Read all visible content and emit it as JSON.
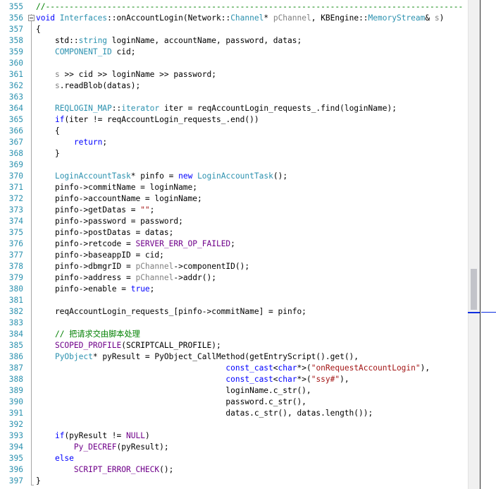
{
  "editor": {
    "first_line_number": 355,
    "lines": [
      {
        "n": "355",
        "t": [
          {
            "c": "cm",
            "s": "//----------------------------------------------------------------------------------------------"
          }
        ]
      },
      {
        "n": "356",
        "t": [
          {
            "c": "kw",
            "s": "void"
          },
          {
            "s": " "
          },
          {
            "c": "ty",
            "s": "Interfaces"
          },
          {
            "s": "::onAccountLogin(Network::"
          },
          {
            "c": "ty",
            "s": "Channel"
          },
          {
            "s": "* "
          },
          {
            "c": "par",
            "s": "pChannel"
          },
          {
            "s": ", KBEngine::"
          },
          {
            "c": "ty",
            "s": "MemoryStream"
          },
          {
            "s": "& "
          },
          {
            "c": "par",
            "s": "s"
          },
          {
            "s": ")"
          }
        ]
      },
      {
        "n": "357",
        "t": [
          {
            "s": "{"
          }
        ]
      },
      {
        "n": "358",
        "t": [
          {
            "s": "    std::"
          },
          {
            "c": "ty",
            "s": "string"
          },
          {
            "s": " loginName, accountName, password, datas;"
          }
        ]
      },
      {
        "n": "359",
        "t": [
          {
            "s": "    "
          },
          {
            "c": "ty",
            "s": "COMPONENT_ID"
          },
          {
            "s": " cid;"
          }
        ]
      },
      {
        "n": "360",
        "t": [
          {
            "s": ""
          }
        ]
      },
      {
        "n": "361",
        "t": [
          {
            "s": "    "
          },
          {
            "c": "par",
            "s": "s"
          },
          {
            "s": " >> cid >> loginName >> password;"
          }
        ]
      },
      {
        "n": "362",
        "t": [
          {
            "s": "    "
          },
          {
            "c": "par",
            "s": "s"
          },
          {
            "s": ".readBlob(datas);"
          }
        ]
      },
      {
        "n": "363",
        "t": [
          {
            "s": ""
          }
        ]
      },
      {
        "n": "364",
        "t": [
          {
            "s": "    "
          },
          {
            "c": "ty",
            "s": "REQLOGIN_MAP"
          },
          {
            "s": "::"
          },
          {
            "c": "ty",
            "s": "iterator"
          },
          {
            "s": " iter = reqAccountLogin_requests_.find(loginName);"
          }
        ]
      },
      {
        "n": "365",
        "t": [
          {
            "s": "    "
          },
          {
            "c": "kw",
            "s": "if"
          },
          {
            "s": "(iter != reqAccountLogin_requests_.end())"
          }
        ]
      },
      {
        "n": "366",
        "t": [
          {
            "s": "    {"
          }
        ]
      },
      {
        "n": "367",
        "t": [
          {
            "s": "        "
          },
          {
            "c": "kw",
            "s": "return"
          },
          {
            "s": ";"
          }
        ]
      },
      {
        "n": "368",
        "t": [
          {
            "s": "    }"
          }
        ]
      },
      {
        "n": "369",
        "t": [
          {
            "s": ""
          }
        ]
      },
      {
        "n": "370",
        "t": [
          {
            "s": "    "
          },
          {
            "c": "ty",
            "s": "LoginAccountTask"
          },
          {
            "s": "* pinfo = "
          },
          {
            "c": "kw",
            "s": "new"
          },
          {
            "s": " "
          },
          {
            "c": "ty",
            "s": "LoginAccountTask"
          },
          {
            "s": "();"
          }
        ]
      },
      {
        "n": "371",
        "t": [
          {
            "s": "    pinfo->commitName = loginName;"
          }
        ]
      },
      {
        "n": "372",
        "t": [
          {
            "s": "    pinfo->accountName = loginName;"
          }
        ]
      },
      {
        "n": "373",
        "t": [
          {
            "s": "    pinfo->getDatas = "
          },
          {
            "c": "str",
            "s": "\"\""
          },
          {
            "s": ";"
          }
        ]
      },
      {
        "n": "374",
        "t": [
          {
            "s": "    pinfo->password = password;"
          }
        ]
      },
      {
        "n": "375",
        "t": [
          {
            "s": "    pinfo->postDatas = datas;"
          }
        ]
      },
      {
        "n": "376",
        "t": [
          {
            "s": "    pinfo->retcode = "
          },
          {
            "c": "mac",
            "s": "SERVER_ERR_OP_FAILED"
          },
          {
            "s": ";"
          }
        ]
      },
      {
        "n": "377",
        "t": [
          {
            "s": "    pinfo->baseappID = cid;"
          }
        ]
      },
      {
        "n": "378",
        "t": [
          {
            "s": "    pinfo->dbmgrID = "
          },
          {
            "c": "par",
            "s": "pChannel"
          },
          {
            "s": "->componentID();"
          }
        ]
      },
      {
        "n": "379",
        "t": [
          {
            "s": "    pinfo->address = "
          },
          {
            "c": "par",
            "s": "pChannel"
          },
          {
            "s": "->addr();"
          }
        ]
      },
      {
        "n": "380",
        "t": [
          {
            "s": "    pinfo->enable = "
          },
          {
            "c": "kw",
            "s": "true"
          },
          {
            "s": ";"
          }
        ]
      },
      {
        "n": "381",
        "t": [
          {
            "s": ""
          }
        ]
      },
      {
        "n": "382",
        "t": [
          {
            "s": "    reqAccountLogin_requests_[pinfo->commitName] = pinfo;"
          }
        ]
      },
      {
        "n": "383",
        "t": [
          {
            "s": ""
          }
        ]
      },
      {
        "n": "384",
        "t": [
          {
            "s": "    "
          },
          {
            "c": "cm",
            "s": "// 把请求交由脚本处理"
          }
        ]
      },
      {
        "n": "385",
        "t": [
          {
            "s": "    "
          },
          {
            "c": "mac",
            "s": "SCOPED_PROFILE"
          },
          {
            "s": "(SCRIPTCALL_PROFILE);"
          }
        ]
      },
      {
        "n": "386",
        "t": [
          {
            "s": "    "
          },
          {
            "c": "ty",
            "s": "PyObject"
          },
          {
            "s": "* pyResult = PyObject_CallMethod(getEntryScript().get(),"
          }
        ]
      },
      {
        "n": "387",
        "t": [
          {
            "s": "                                        "
          },
          {
            "c": "kw",
            "s": "const_cast"
          },
          {
            "s": "<"
          },
          {
            "c": "kw",
            "s": "char"
          },
          {
            "s": "*>("
          },
          {
            "c": "str",
            "s": "\"onRequestAccountLogin\""
          },
          {
            "s": "),"
          }
        ]
      },
      {
        "n": "388",
        "t": [
          {
            "s": "                                        "
          },
          {
            "c": "kw",
            "s": "const_cast"
          },
          {
            "s": "<"
          },
          {
            "c": "kw",
            "s": "char"
          },
          {
            "s": "*>("
          },
          {
            "c": "str",
            "s": "\"ssy#\""
          },
          {
            "s": "),"
          }
        ]
      },
      {
        "n": "389",
        "t": [
          {
            "s": "                                        loginName.c_str(),"
          }
        ]
      },
      {
        "n": "390",
        "t": [
          {
            "s": "                                        password.c_str(),"
          }
        ]
      },
      {
        "n": "391",
        "t": [
          {
            "s": "                                        datas.c_str(), datas.length());"
          }
        ]
      },
      {
        "n": "392",
        "t": [
          {
            "s": ""
          }
        ]
      },
      {
        "n": "393",
        "t": [
          {
            "s": "    "
          },
          {
            "c": "kw",
            "s": "if"
          },
          {
            "s": "(pyResult != "
          },
          {
            "c": "mac",
            "s": "NULL"
          },
          {
            "s": ")"
          }
        ]
      },
      {
        "n": "394",
        "t": [
          {
            "s": "        "
          },
          {
            "c": "mac",
            "s": "Py_DECREF"
          },
          {
            "s": "(pyResult);"
          }
        ]
      },
      {
        "n": "395",
        "t": [
          {
            "s": "    "
          },
          {
            "c": "kw",
            "s": "else"
          }
        ]
      },
      {
        "n": "396",
        "t": [
          {
            "s": "        "
          },
          {
            "c": "mac",
            "s": "SCRIPT_ERROR_CHECK"
          },
          {
            "s": "();"
          }
        ]
      },
      {
        "n": "397",
        "t": [
          {
            "s": "}"
          }
        ]
      }
    ],
    "colors": {
      "keyword": "#0000ff",
      "type": "#2b91af",
      "macro": "#6f008a",
      "string": "#a31515",
      "comment": "#008000",
      "parameter": "#808080",
      "line_number": "#2b91af"
    }
  }
}
